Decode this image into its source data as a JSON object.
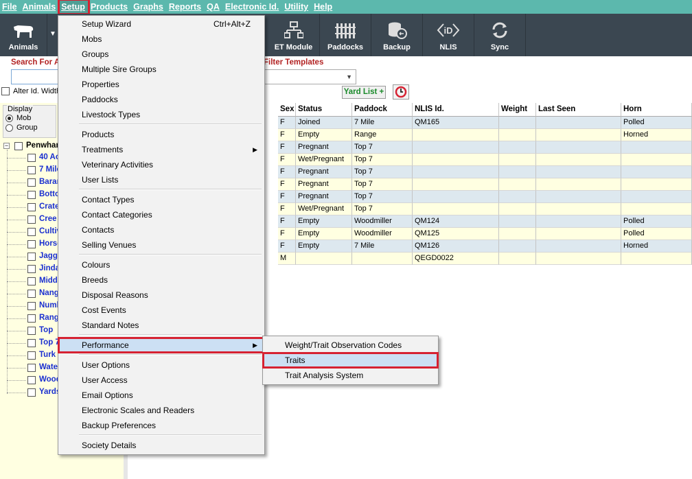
{
  "menubar": [
    "File",
    "Animals",
    "Setup",
    "Products",
    "Graphs",
    "Reports",
    "QA",
    "Electronic Id.",
    "Utility",
    "Help"
  ],
  "toolbar": {
    "animals": "Animals",
    "et_module": "ET Module",
    "paddocks": "Paddocks",
    "backup": "Backup",
    "nlis": "NLIS",
    "sync": "Sync"
  },
  "search": {
    "label": "Search For A",
    "value": ""
  },
  "filter": {
    "label": "Filter Templates",
    "value": ""
  },
  "alter_label": "Alter Id. Width",
  "yard_list": "Yard List +",
  "display": {
    "title": "Display",
    "mob": "Mob",
    "group": "Group"
  },
  "tree": {
    "root": "Penwhar",
    "items": [
      "40 Ac",
      "7 Mile",
      "Baran",
      "Botto",
      "Crate",
      "Cree",
      "Cultiv",
      "Horse",
      "Jagg",
      "Jinda",
      "Midd",
      "Nang",
      "Numb",
      "Rang",
      "Top",
      "Top 7",
      "Turk",
      "Wate",
      "Wood",
      "Yards"
    ]
  },
  "grid": {
    "headers": [
      "Sex",
      "Status",
      "Paddock",
      "NLIS Id.",
      "Weight",
      "Last Seen",
      "Horn"
    ],
    "rows": [
      [
        "F",
        "Joined",
        "7 Mile",
        "QM165",
        "",
        "",
        "Polled"
      ],
      [
        "F",
        "Empty",
        "Range",
        "",
        "",
        "",
        "Horned"
      ],
      [
        "F",
        "Pregnant",
        "Top 7",
        "",
        "",
        "",
        ""
      ],
      [
        "F",
        "Wet/Pregnant",
        "Top 7",
        "",
        "",
        "",
        ""
      ],
      [
        "F",
        "Pregnant",
        "Top 7",
        "",
        "",
        "",
        ""
      ],
      [
        "F",
        "Pregnant",
        "Top 7",
        "",
        "",
        "",
        ""
      ],
      [
        "F",
        "Pregnant",
        "Top 7",
        "",
        "",
        "",
        ""
      ],
      [
        "F",
        "Wet/Pregnant",
        "Top 7",
        "",
        "",
        "",
        ""
      ],
      [
        "F",
        "Empty",
        "Woodmiller",
        "QM124",
        "",
        "",
        "Polled"
      ],
      [
        "F",
        "Empty",
        "Woodmiller",
        "QM125",
        "",
        "",
        "Polled"
      ],
      [
        "F",
        "Empty",
        "7 Mile",
        "QM126",
        "",
        "",
        "Horned"
      ],
      [
        "M",
        "",
        "",
        "QEGD0022",
        "",
        "",
        ""
      ]
    ]
  },
  "setup_menu": {
    "items": [
      {
        "label": "Setup Wizard",
        "shortcut": "Ctrl+Alt+Z"
      },
      {
        "label": "Mobs"
      },
      {
        "label": "Groups"
      },
      {
        "label": "Multiple Sire Groups"
      },
      {
        "label": "Properties"
      },
      {
        "label": "Paddocks"
      },
      {
        "label": "Livestock Types"
      },
      {
        "label": "Products"
      },
      {
        "label": "Treatments"
      },
      {
        "label": "Veterinary Activities"
      },
      {
        "label": "User Lists"
      },
      {
        "label": "Contact Types"
      },
      {
        "label": "Contact Categories"
      },
      {
        "label": "Contacts"
      },
      {
        "label": "Selling Venues"
      },
      {
        "label": "Colours"
      },
      {
        "label": "Breeds"
      },
      {
        "label": "Disposal Reasons"
      },
      {
        "label": "Cost Events"
      },
      {
        "label": "Standard Notes"
      },
      {
        "label": "Performance"
      },
      {
        "label": "User Options"
      },
      {
        "label": "User Access"
      },
      {
        "label": "Email Options"
      },
      {
        "label": "Electronic Scales and Readers"
      },
      {
        "label": "Backup Preferences"
      },
      {
        "label": "Society Details"
      }
    ]
  },
  "performance_menu": {
    "items": [
      "Weight/Trait Observation Codes",
      "Traits",
      "Trait Analysis System"
    ]
  },
  "colors": {
    "menubar": "#5cb8ad",
    "toolbar": "#3b4751",
    "highlight": "#d62232",
    "tree_link": "#1a2fd0"
  }
}
